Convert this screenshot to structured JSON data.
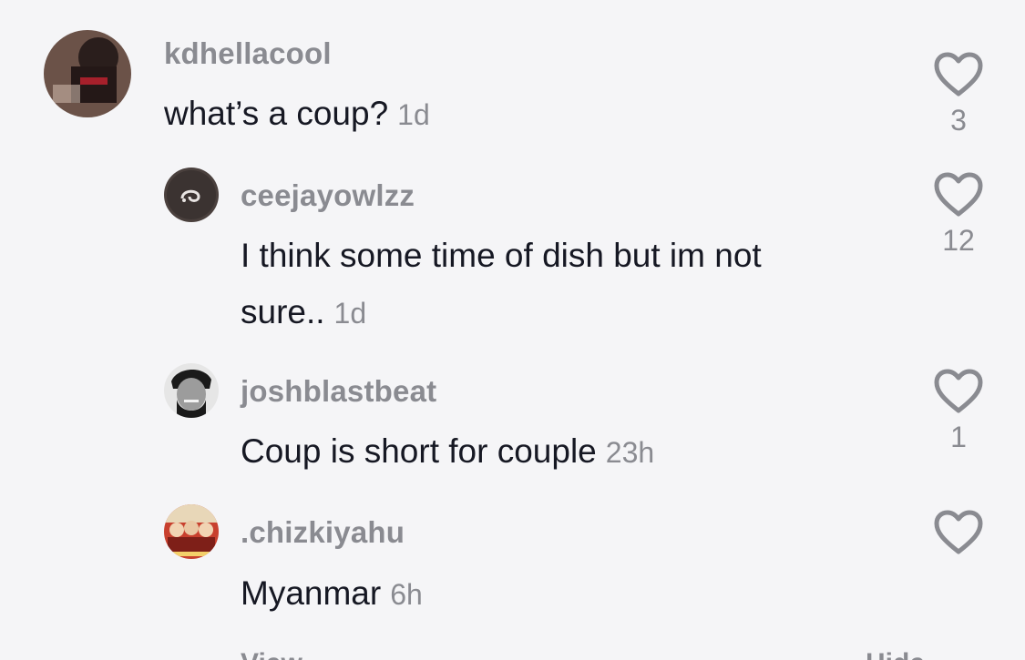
{
  "comments": [
    {
      "username": "kdhellacool",
      "text": "what’s a coup?",
      "time": "1d",
      "likes": "3",
      "avatar_icon": "user-avatar-dark-photo"
    },
    {
      "username": "ceejayowlzz",
      "text": "I think some time of dish but im not sure..",
      "time": "1d",
      "likes": "12",
      "avatar_icon": "user-avatar-swirl-logo"
    },
    {
      "username": "joshblastbeat",
      "text": "Coup is short for couple",
      "time": "23h",
      "likes": "1",
      "avatar_icon": "user-avatar-portrait"
    },
    {
      "username": ".chizkiyahu",
      "text": "Myanmar",
      "time": "6h",
      "likes": "",
      "avatar_icon": "user-avatar-poster"
    }
  ],
  "footer": {
    "view_replies": "View",
    "hide": "Hide"
  },
  "colors": {
    "background": "#f5f5f7",
    "text": "#161823",
    "secondary": "#8a8b91"
  }
}
